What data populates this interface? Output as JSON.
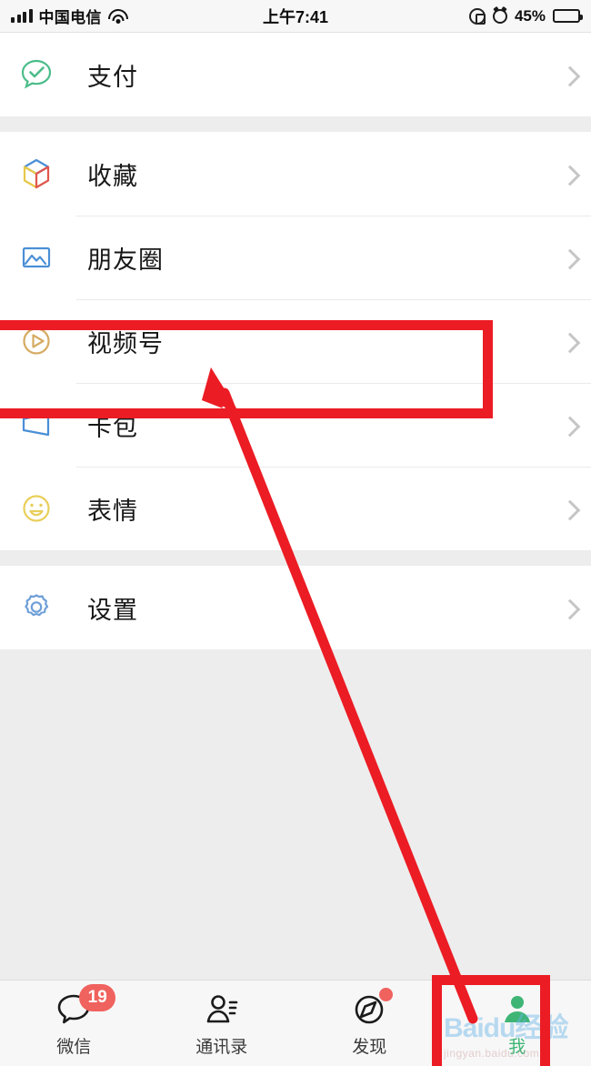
{
  "statusbar": {
    "carrier": "中国电信",
    "time": "上午7:41",
    "battery_percent": "45%",
    "icons": {
      "signal": "signal-bars-icon",
      "wifi": "wifi-icon",
      "rotation_lock": "rotation-lock-icon",
      "alarm": "alarm-clock-icon",
      "battery": "battery-icon"
    }
  },
  "list": {
    "groups": [
      {
        "rows": [
          {
            "label": "支付",
            "icon": "pay-icon",
            "chevron": "chevron-right-icon"
          }
        ]
      },
      {
        "rows": [
          {
            "label": "收藏",
            "icon": "favorites-icon",
            "chevron": "chevron-right-icon"
          },
          {
            "label": "朋友圈",
            "icon": "moments-icon",
            "chevron": "chevron-right-icon"
          },
          {
            "label": "视频号",
            "icon": "channels-icon",
            "chevron": "chevron-right-icon"
          },
          {
            "label": "卡包",
            "icon": "cards-icon",
            "chevron": "chevron-right-icon"
          },
          {
            "label": "表情",
            "icon": "stickers-icon",
            "chevron": "chevron-right-icon"
          }
        ]
      },
      {
        "rows": [
          {
            "label": "设置",
            "icon": "settings-gear-icon",
            "chevron": "chevron-right-icon"
          }
        ]
      }
    ]
  },
  "tabbar": {
    "tabs": [
      {
        "label": "微信",
        "icon": "chat-bubble-icon",
        "badge": "19",
        "active": false
      },
      {
        "label": "通讯录",
        "icon": "contacts-icon",
        "badge": "",
        "active": false
      },
      {
        "label": "发现",
        "icon": "compass-icon",
        "badge": "",
        "dot": true,
        "active": false
      },
      {
        "label": "我",
        "icon": "person-icon",
        "badge": "",
        "active": true
      }
    ]
  },
  "annotations": {
    "highlight_color": "#ec1c24",
    "boxes": [
      {
        "name": "channels-row-highlight",
        "target": "视频号"
      },
      {
        "name": "me-tab-highlight",
        "target": "我"
      }
    ],
    "arrow": {
      "name": "pointer-arrow",
      "from": "我",
      "to": "视频号"
    }
  },
  "watermark": {
    "main": "Baidu经验",
    "sub": "jingyan.baidu.com"
  },
  "colors": {
    "pay_green": "#4cbd8a",
    "moments_blue": "#4a8fd6",
    "channels_gold": "#d6ab63",
    "cards_blue": "#4a8fd6",
    "stickers_yellow": "#e9cf5a",
    "settings_blue": "#6e9fd8",
    "badge_red": "#f0625e",
    "active_green": "#3eb575",
    "annotation_red": "#ec1c24"
  }
}
